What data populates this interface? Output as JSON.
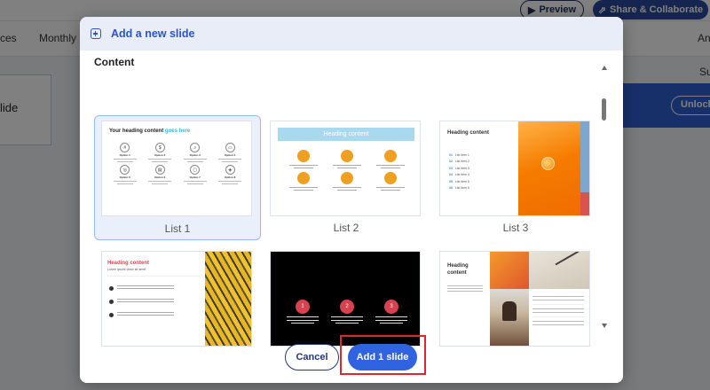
{
  "background": {
    "preview_label": "Preview",
    "share_label": "Share & Collaborate",
    "toolbar_left": "ces",
    "toolbar_monthly": "Monthly se",
    "toolbar_right": "An",
    "side_text": "lide",
    "right_label": "Su",
    "unlock_label": "Unlock f"
  },
  "modal": {
    "title": "Add a new slide",
    "section_title": "Content",
    "templates": [
      {
        "label": "List 1",
        "selected": true
      },
      {
        "label": "List 2",
        "selected": false
      },
      {
        "label": "List 3",
        "selected": false
      },
      {
        "label": "",
        "selected": false
      },
      {
        "label": "",
        "selected": false
      },
      {
        "label": "",
        "selected": false
      }
    ],
    "thumb1": {
      "title": "Your heading content",
      "title_accent": "goes here",
      "options": [
        "Option 1",
        "Option 2",
        "Option 3",
        "Option 4",
        "Option 5",
        "Option 6",
        "Option 7",
        "Option 8"
      ]
    },
    "thumb2": {
      "title": "Heading content"
    },
    "thumb3": {
      "title": "Heading content",
      "items": [
        {
          "num": "01",
          "text": "List item 1"
        },
        {
          "num": "02",
          "text": "List item 2"
        },
        {
          "num": "03",
          "text": "List item 3"
        },
        {
          "num": "04",
          "text": "List item 4"
        },
        {
          "num": "05",
          "text": "List item 5"
        },
        {
          "num": "06",
          "text": "List item 6"
        }
      ]
    },
    "thumb4": {
      "title": "Heading content",
      "subtitle": "Lorem ipsum dolor sit amet"
    },
    "thumb5": {
      "numbers": [
        "1",
        "2",
        "3"
      ]
    },
    "thumb6": {
      "title_line1": "Heading",
      "title_line2": "content"
    },
    "cancel_label": "Cancel",
    "add_label": "Add 1 slide"
  },
  "colors": {
    "accent_blue": "#2f63df",
    "header_blue": "#2b54c9",
    "highlight_red": "#e0262d",
    "selected_bg": "#eaf0fb"
  }
}
